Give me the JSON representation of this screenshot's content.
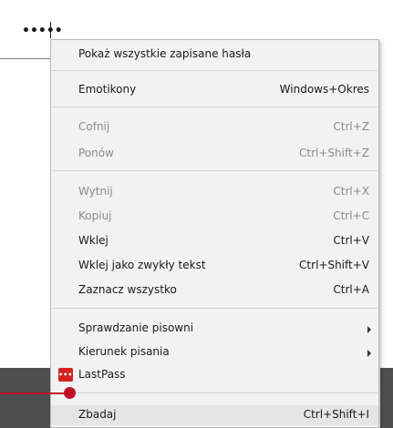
{
  "password_field": {
    "value": "•••••"
  },
  "menu": {
    "items": [
      {
        "label": "Pokaż wszystkie zapisane hasła",
        "shortcut": ""
      },
      {
        "label": "Emotikony",
        "shortcut": "Windows+Okres"
      },
      {
        "label": "Cofnij",
        "shortcut": "Ctrl+Z"
      },
      {
        "label": "Ponów",
        "shortcut": "Ctrl+Shift+Z"
      },
      {
        "label": "Wytnij",
        "shortcut": "Ctrl+X"
      },
      {
        "label": "Kopiuj",
        "shortcut": "Ctrl+C"
      },
      {
        "label": "Wklej",
        "shortcut": "Ctrl+V"
      },
      {
        "label": "Wklej jako zwykły tekst",
        "shortcut": "Ctrl+Shift+V"
      },
      {
        "label": "Zaznacz wszystko",
        "shortcut": "Ctrl+A"
      },
      {
        "label": "Sprawdzanie pisowni",
        "shortcut": ""
      },
      {
        "label": "Kierunek pisania",
        "shortcut": ""
      },
      {
        "label": "LastPass",
        "shortcut": "",
        "icon_text": "•••|"
      },
      {
        "label": "Zbadaj",
        "shortcut": "Ctrl+Shift+I"
      }
    ]
  },
  "colors": {
    "callout": "#c0102a",
    "lastpass_red": "#d42020",
    "menu_bg": "#f2f2f2"
  },
  "icons": {
    "lastpass": "lastpass-icon",
    "submenu": "chevron-right-icon",
    "callout": "callout-marker"
  }
}
